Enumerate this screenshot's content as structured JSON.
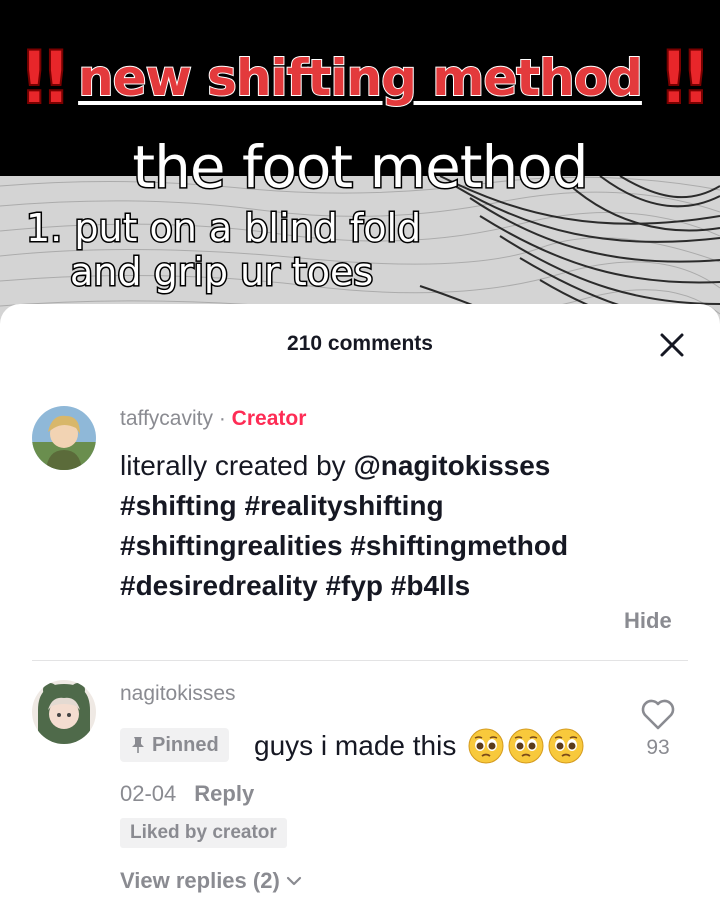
{
  "video": {
    "banner_left": "!!",
    "banner_text": "new shifting method",
    "banner_right": "!!",
    "subtitle": "the foot method",
    "step_line1": "1. put on a blind fold",
    "step_line2": "and grip ur toes"
  },
  "sheet": {
    "title": "210 comments",
    "close_icon": "close-icon"
  },
  "comments": [
    {
      "username": "taffycavity",
      "separator": "·",
      "creator_label": "Creator",
      "text_plain": "literally created by",
      "mention": "@nagitokisses",
      "hashtags_line1": "#shifting #realityshifting",
      "hashtags_line2": "#shiftingrealities #shiftingmethod",
      "hashtags_line3": "#desiredreality #fyp #b4lls",
      "hide_label": "Hide"
    },
    {
      "username": "nagitokisses",
      "pinned_label": "Pinned",
      "text": "guys i made this",
      "emoji": [
        "pleading-face-emoji",
        "pleading-face-emoji",
        "pleading-face-emoji"
      ],
      "like_count": "93",
      "date": "02-04",
      "reply_label": "Reply",
      "liked_by": "Liked by creator",
      "view_replies": "View replies (2)"
    }
  ],
  "colors": {
    "creator": "#fe2c55",
    "muted": "#8a8b91",
    "text": "#161823",
    "banner_red": "#e33a3c"
  }
}
